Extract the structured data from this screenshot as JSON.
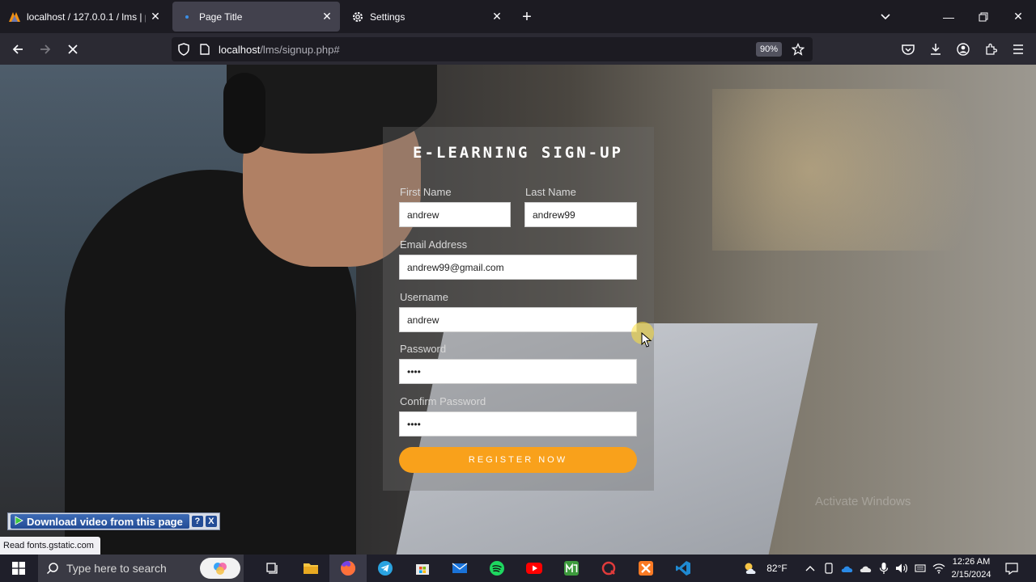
{
  "browser": {
    "tabs": [
      {
        "label": "localhost / 127.0.0.1 / lms | php",
        "active": false
      },
      {
        "label": "Page Title",
        "active": true
      },
      {
        "label": "Settings",
        "active": false
      }
    ],
    "url": {
      "host": "localhost",
      "path": "/lms/signup.php#"
    },
    "zoom": "90%",
    "status_text": "Read fonts.gstatic.com"
  },
  "form": {
    "title": "E-LEARNING SIGN-UP",
    "first_name": {
      "label": "First Name",
      "value": "andrew"
    },
    "last_name": {
      "label": "Last Name",
      "value": "andrew99"
    },
    "email": {
      "label": "Email Address",
      "value": "andrew99@gmail.com"
    },
    "username": {
      "label": "Username",
      "value": "andrew"
    },
    "password": {
      "label": "Password",
      "value": "••••"
    },
    "confirm_password": {
      "label": "Confirm Password",
      "value": "••••"
    },
    "submit_label": "REGISTER NOW",
    "accent_color": "#f9a11b"
  },
  "overlay": {
    "download_label": "Download video from this page",
    "help_label": "?",
    "close_label": "X",
    "watermark": "Activate Windows"
  },
  "taskbar": {
    "search_placeholder": "Type here to search",
    "weather": "82°F",
    "time": "12:26 AM",
    "date": "2/15/2024"
  }
}
